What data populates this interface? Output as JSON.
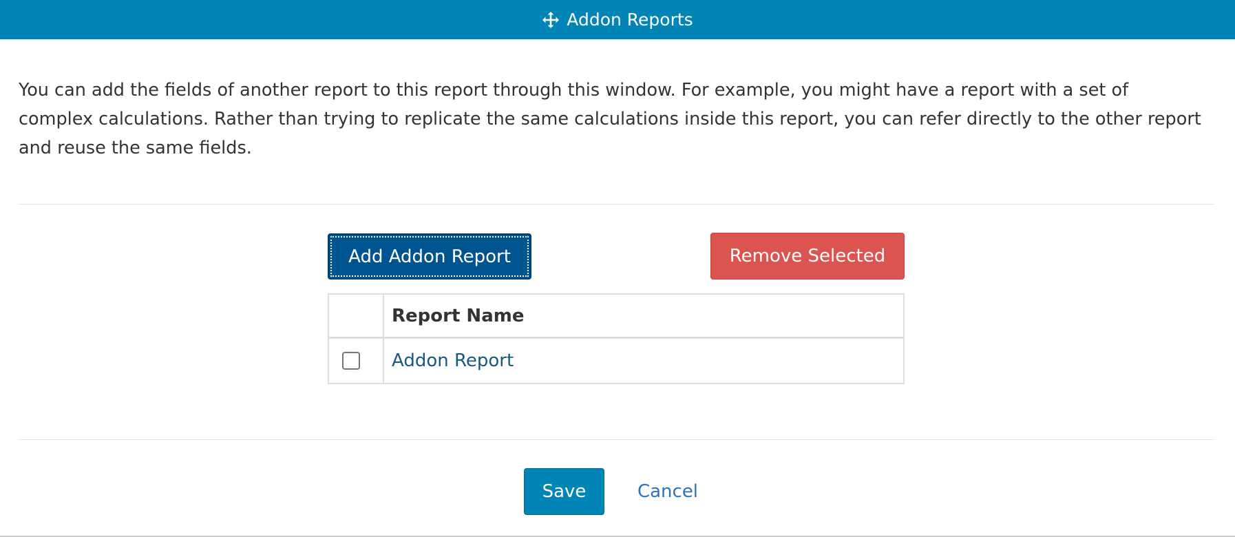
{
  "dialog": {
    "title": "Addon Reports",
    "title_icon": "move-arrows-icon",
    "description": "You can add the fields of another report to this report through this window. For example, you might have a report with a set of complex calculations. Rather than trying to replicate the same calculations inside this report, you can refer directly to the other report and reuse the same fields."
  },
  "toolbar": {
    "add_label": "Add Addon Report",
    "remove_label": "Remove Selected"
  },
  "table": {
    "header": {
      "name": "Report Name"
    },
    "rows": [
      {
        "checked": false,
        "name": "Addon Report"
      }
    ]
  },
  "footer": {
    "save_label": "Save",
    "cancel_label": "Cancel"
  },
  "colors": {
    "titlebar": "#0085b6",
    "add_button": "#00548f",
    "remove_button": "#dc5450",
    "save_button": "#0085b6",
    "link": "#2b73b6"
  }
}
